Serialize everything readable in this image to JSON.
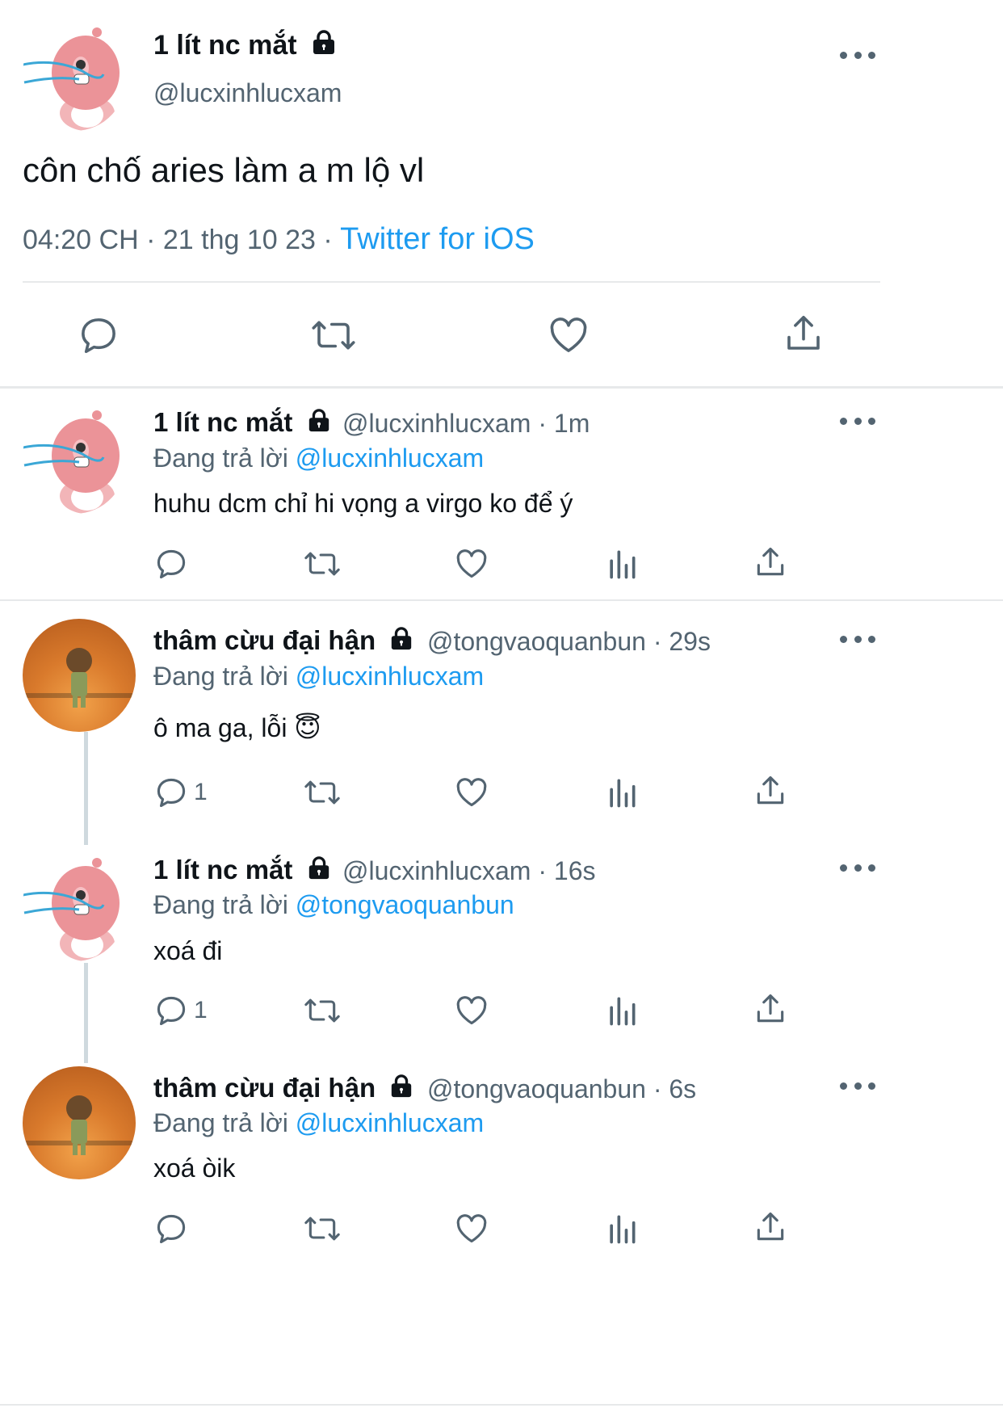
{
  "main_tweet": {
    "name": "1 lít nc mắt",
    "handle": "@lucxinhlucxam",
    "text": "côn chố aries làm a m lộ vl",
    "time": "04:20 CH",
    "sep": "·",
    "date": "21 thg 10 23",
    "source": "Twitter for iOS"
  },
  "replies": [
    {
      "name": "1 lít nc mắt",
      "handle": "@lucxinhlucxam · 1m",
      "replying_label": "Đang trả lời",
      "replying_to": "@lucxinhlucxam",
      "text": "huhu dcm chỉ hi vọng a virgo ko để ý",
      "reply_count": ""
    },
    {
      "name": "thâm cừu đại hận",
      "handle": "@tongvaoquanbun · 29s",
      "replying_label": "Đang trả lời",
      "replying_to": "@lucxinhlucxam",
      "text": "ô ma ga, lỗi 😇",
      "reply_count": "1"
    },
    {
      "name": "1 lít nc mắt",
      "handle": "@lucxinhlucxam · 16s",
      "replying_label": "Đang trả lời",
      "replying_to": "@tongvaoquanbun",
      "text": "xoá đi",
      "reply_count": "1"
    },
    {
      "name": "thâm cừu đại hận",
      "handle": "@tongvaoquanbun · 6s",
      "replying_label": "Đang trả lời",
      "replying_to": "@lucxinhlucxam",
      "text": "xoá òik",
      "reply_count": ""
    }
  ],
  "icons": {
    "reply": "speech-bubble-icon",
    "retweet": "retweet-arrows-icon",
    "like": "heart-icon",
    "analytics": "bar-chart-icon",
    "share": "share-upload-icon",
    "more": "ellipsis-icon",
    "lock": "lock-icon"
  },
  "colors": {
    "link": "#1d9bf0",
    "meta": "#536471",
    "text": "#0f1419",
    "divider": "#e7e9ea"
  }
}
